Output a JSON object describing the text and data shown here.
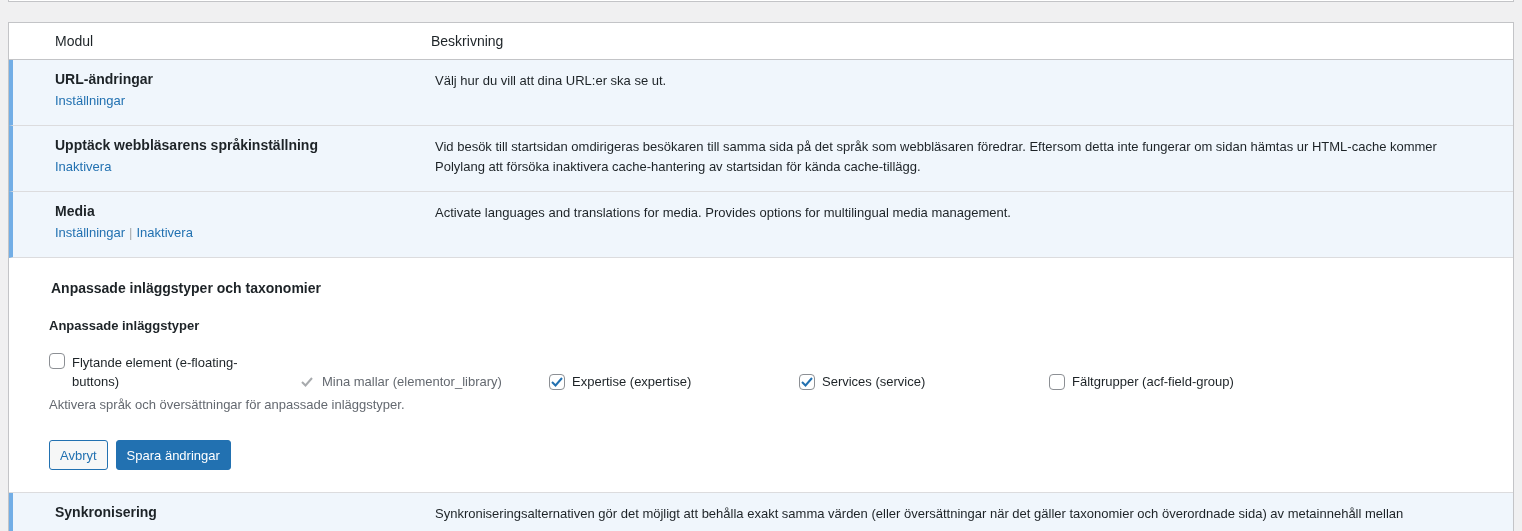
{
  "table": {
    "columns": [
      "Modul",
      "Beskrivning"
    ],
    "rows": [
      {
        "kind": "module",
        "active": true,
        "name": "URL-ändringar",
        "actions": [
          "Inställningar"
        ],
        "description": "Välj hur du vill att dina URL:er ska se ut."
      },
      {
        "kind": "module",
        "active": true,
        "name": "Upptäck webbläsarens språkinställning",
        "actions": [
          "Inaktivera"
        ],
        "description": "Vid besök till startsidan omdirigeras besökaren till samma sida på det språk som webbläsaren föredrar. Eftersom detta inte fungerar om sidan hämtas ur HTML-cache kommer Polylang att försöka inaktivera cache-hantering av startsidan för kända cache-tillägg."
      },
      {
        "kind": "module",
        "active": true,
        "name": "Media",
        "actions": [
          "Inställningar",
          "Inaktivera"
        ],
        "separator": "|",
        "description": "Activate languages and translations for media. Provides options for multilingual media management."
      },
      {
        "kind": "settings",
        "title": "Anpassade inläggstyper och taxonomier",
        "subtitle": "Anpassade inläggstyper",
        "options": [
          {
            "label": "Flytande element (e-floating-buttons)",
            "checked": false,
            "disabled": false
          },
          {
            "label": "Mina mallar (elementor_library)",
            "checked": true,
            "disabled": true
          },
          {
            "label": "Expertise (expertise)",
            "checked": true,
            "disabled": false
          },
          {
            "label": "Services (service)",
            "checked": true,
            "disabled": false
          },
          {
            "label": "Fältgrupper (acf-field-group)",
            "checked": false,
            "disabled": false
          }
        ],
        "hint": "Aktivera språk och översättningar för anpassade inläggstyper.",
        "buttons": [
          {
            "label": "Avbryt",
            "kind": "secondary"
          },
          {
            "label": "Spara ändringar",
            "kind": "primary"
          }
        ]
      },
      {
        "kind": "module",
        "active": true,
        "name": "Synkronisering",
        "actions": [],
        "description": "Synkroniseringsalternativen gör det möjligt att behålla exakt samma värden (eller översättningar när det gäller taxonomier och överordnade sida) av metainnehåll mellan"
      }
    ]
  }
}
